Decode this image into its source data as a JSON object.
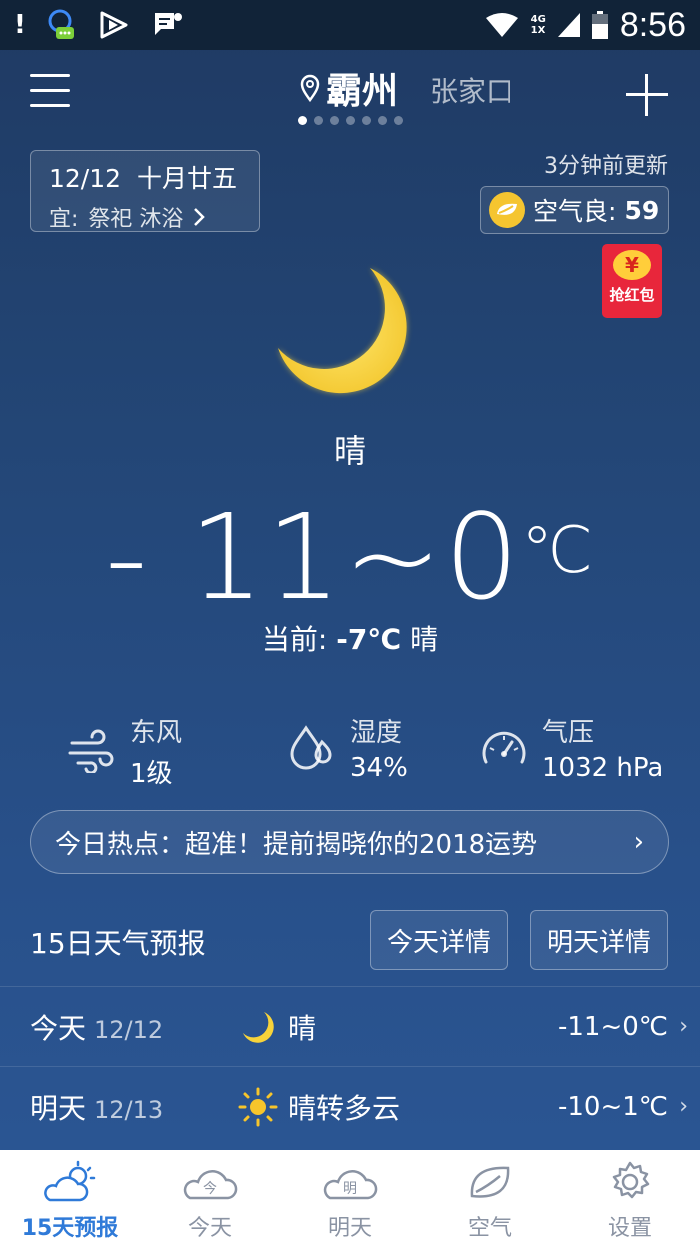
{
  "status_bar": {
    "notification": "!",
    "network_top": "4G",
    "network_bottom": "1X",
    "time": "8:56"
  },
  "header": {
    "city": "霸州",
    "next_city": "张家口",
    "page_count": 7,
    "active_page": 1
  },
  "date_box": {
    "date": "12/12",
    "lunar": "十月廿五",
    "yi_label": "宜:",
    "yi_items": "祭祀 沐浴"
  },
  "update_text": "3分钟前更新",
  "aqi": {
    "label": "空气良:",
    "value": "59",
    "color": "#f5c530"
  },
  "red_packet": {
    "coin": "¥",
    "label": "抢红包"
  },
  "weather": {
    "condition": "晴",
    "temp_range": "- 11~0",
    "temp_unit": "℃",
    "current_label": "当前:",
    "current_temp": "-7℃",
    "current_condition": "晴"
  },
  "metrics": {
    "wind": {
      "label": "东风",
      "value": "1级",
      "icon": "wind-icon"
    },
    "humidity": {
      "label": "湿度",
      "value": "34%",
      "icon": "drop-icon"
    },
    "pressure": {
      "label": "气压",
      "value": "1032 hPa",
      "icon": "gauge-icon"
    }
  },
  "hot_news": {
    "text": "今日热点：超准！提前揭晓你的2018运势",
    "chevron": "›"
  },
  "forecast": {
    "title": "15日天气预报",
    "today_btn": "今天详情",
    "tomorrow_btn": "明天详情",
    "rows": [
      {
        "day": "今天",
        "date": "12/12",
        "icon": "moon-icon",
        "desc": "晴",
        "range": "-11~0℃"
      },
      {
        "day": "明天",
        "date": "12/13",
        "icon": "sun-icon",
        "desc": "晴转多云",
        "range": "-10~1℃"
      }
    ]
  },
  "tabs": [
    {
      "label": "15天预报",
      "icon": "cloud-sun-icon",
      "active": true
    },
    {
      "label": "今天",
      "icon": "cloud-today-icon",
      "glyph": "今"
    },
    {
      "label": "明天",
      "icon": "cloud-tomorrow-icon",
      "glyph": "明"
    },
    {
      "label": "空气",
      "icon": "leaf-icon"
    },
    {
      "label": "设置",
      "icon": "gear-icon"
    }
  ],
  "colors": {
    "tab_active": "#2f7ad8",
    "tab_inactive": "#8a93a3",
    "moon_yellow": "#f7d33a"
  }
}
